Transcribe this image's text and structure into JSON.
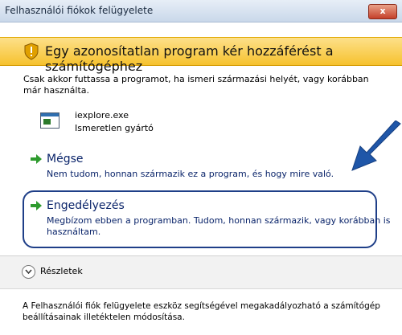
{
  "window": {
    "title": "Felhasználói fiókok felügyelete",
    "close_label": "x"
  },
  "banner": {
    "text": "Egy azonosítatlan program kér hozzáférést a számítógéphez"
  },
  "intro_text": "Csak akkor futtassa a programot, ha ismeri származási helyét, vagy korábban már használta.",
  "program": {
    "name": "iexplore.exe",
    "publisher": "Ismeretlen gyártó"
  },
  "options": {
    "cancel": {
      "title": "Mégse",
      "description": "Nem tudom, honnan származik ez a program, és hogy mire való."
    },
    "allow": {
      "title": "Engedélyezés",
      "description": "Megbízom ebben a programban. Tudom, honnan származik, vagy korábban is használtam."
    }
  },
  "details": {
    "label": "Részletek"
  },
  "footer_text": "A Felhasználói fiók felügyelete eszköz segítségével megakadályozható a számítógép beállításainak illetéktelen módosítása.",
  "colors": {
    "banner": "#f6c22e",
    "option_text": "#0a246a",
    "highlight": "#1f3f88"
  }
}
